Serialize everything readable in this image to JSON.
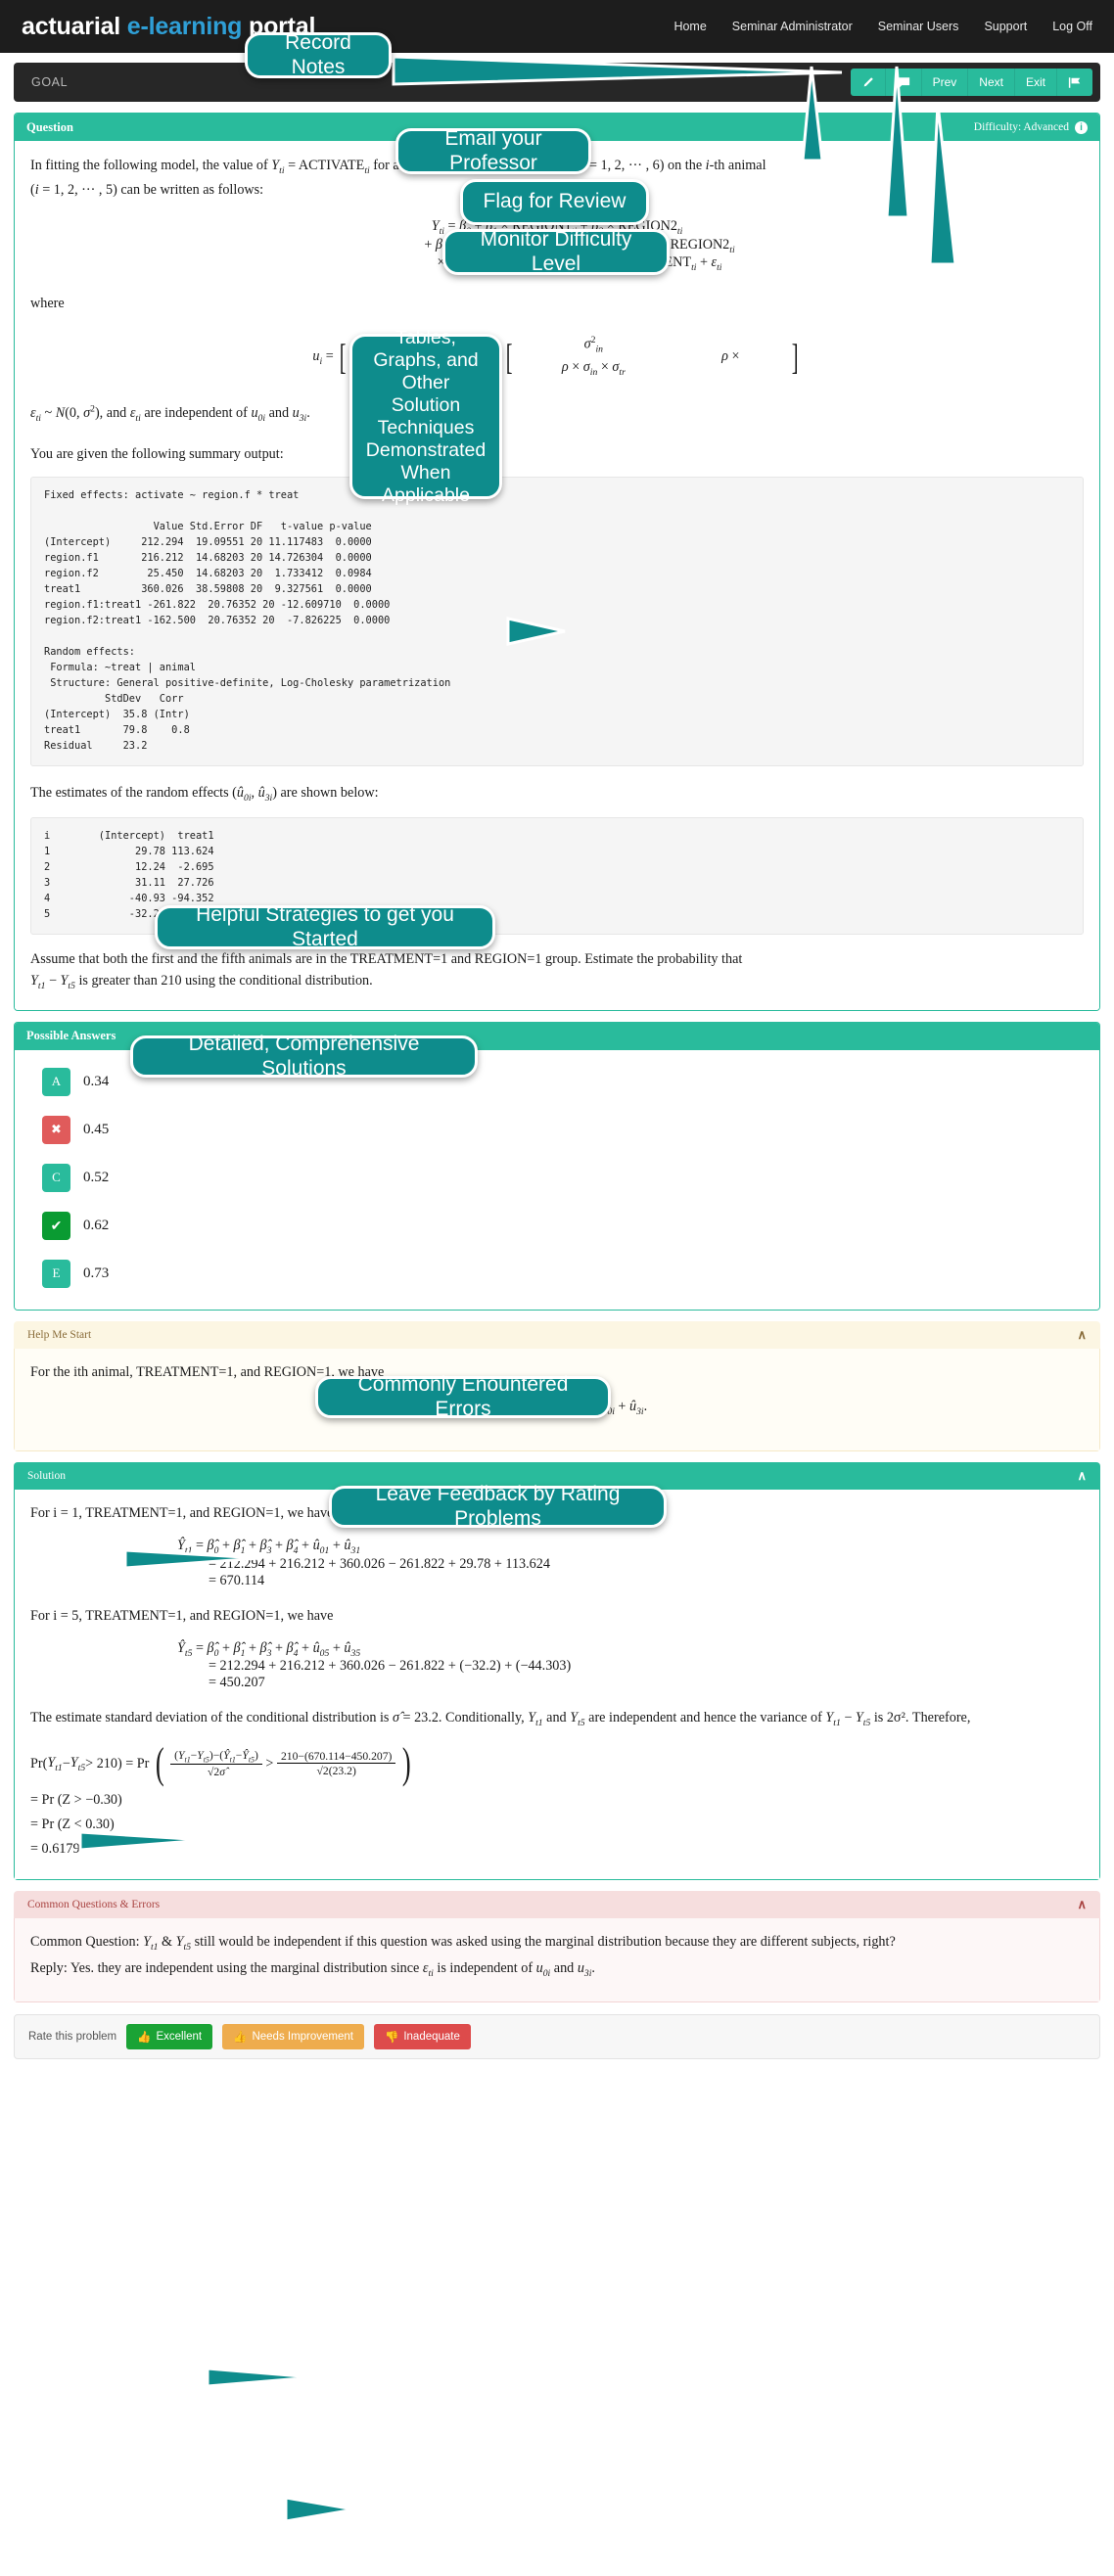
{
  "header": {
    "brand_part1": "actuarial ",
    "brand_part2": "e-learning",
    "brand_part3": " portal",
    "nav": [
      {
        "label": "Home"
      },
      {
        "label": "Seminar Administrator"
      },
      {
        "label": "Seminar Users"
      },
      {
        "label": "Support"
      },
      {
        "label": "Log Off"
      }
    ]
  },
  "goalbar": {
    "label": "GOAL",
    "buttons": [
      {
        "name": "pencil",
        "label": ""
      },
      {
        "name": "comment",
        "label": ""
      },
      {
        "name": "prev",
        "label": "Prev"
      },
      {
        "name": "next",
        "label": "Next"
      },
      {
        "name": "exit",
        "label": "Exit"
      },
      {
        "name": "flag",
        "label": ""
      }
    ]
  },
  "question": {
    "title": "Question",
    "difficulty_label": "Difficulty: Advanced",
    "info_glyph": "i",
    "intro_line1_a": "In fitting the following model, the value of ",
    "intro_line1_b": " for a given observation indexed by ",
    "intro_line1_c": " on the ",
    "intro_line1_d": "-th animal",
    "intro_line2": " can be written as follows:",
    "where_label": "where",
    "epsilon_line": " are independent of ",
    "summary_line": "You are given that the following summary output:",
    "summary_intro": "You are given the following summary output:",
    "code_fixed": "Fixed effects: activate ~ region.f * treat\n\n                  Value Std.Error DF   t-value p-value\n(Intercept)     212.294  19.09551 20 11.117483  0.0000\nregion.f1       216.212  14.68203 20 14.726304  0.0000\nregion.f2        25.450  14.68203 20  1.733412  0.0984\ntreat1          360.026  38.59808 20  9.327561  0.0000\nregion.f1:treat1 -261.822  20.76352 20 -12.609710  0.0000\nregion.f2:treat1 -162.500  20.76352 20  -7.826225  0.0000\n\nRandom effects:\n Formula: ~treat | animal\n Structure: General positive-definite, Log-Cholesky parametrization\n          StdDev   Corr\n(Intercept)  35.8 (Intr)\ntreat1       79.8    0.8\nResidual     23.2",
    "random_effects_intro": "The estimates of the random effects ",
    "random_effects_intro_tail": " are shown below:",
    "code_random": "i        (Intercept)  treat1\n1              29.78 113.624\n2              12.24  -2.695\n3              31.11  27.726\n4             -40.93 -94.352\n5             -32.20 -44.303",
    "closing_line1": "Assume that both the first and the fifth animals are in the TREATMENT=1 and REGION=1 group. Estimate the probability that",
    "closing_line2_tail": " is greater than 210 using the conditional distribution."
  },
  "answers": {
    "title": "Possible Answers",
    "options": [
      {
        "badge": "A",
        "state": "normal",
        "value": "0.34"
      },
      {
        "badge": "✖",
        "state": "wrong",
        "value": "0.45"
      },
      {
        "badge": "C",
        "state": "normal",
        "value": "0.52"
      },
      {
        "badge": "✔",
        "state": "right",
        "value": "0.62"
      },
      {
        "badge": "E",
        "state": "normal",
        "value": "0.73"
      }
    ]
  },
  "hint": {
    "title": "Help Me Start",
    "chevron": "∧",
    "text": "For the ith animal, TREATMENT=1, and REGION=1, we have"
  },
  "solution": {
    "title": "Solution",
    "chevron": "∧",
    "line1": "For i = 1, TREATMENT=1, and REGION=1, we have",
    "eq1_values": "= 212.294 + 216.212 + 360.026 − 261.822 + 29.78 + 113.624",
    "eq1_result": "= 670.114",
    "line2": "For i = 5, TREATMENT=1, and REGION=1, we have",
    "eq2_values": "= 212.294 + 216.212 + 360.026 − 261.822 + (−32.2) + (−44.303)",
    "eq2_result": "= 450.207",
    "sigma_text_a": "The estimate standard deviation of the conditional distribution is ",
    "sigma_value": "= 23.2",
    "sigma_text_b": ". Conditionally, ",
    "sigma_text_c": " are independent and hence the variance of ",
    "sigma_text_d": " is 2σ². Therefore,",
    "pr_num_right": "210−(670.114−450.207)",
    "pr_den_right": "√2(23.2)",
    "step1": "= Pr (Z > −0.30)",
    "step2": "= Pr (Z < 0.30)",
    "step3": "= 0.6179"
  },
  "cqe": {
    "title": "Common Questions & Errors",
    "chevron": "∧",
    "q_prefix": "Common Question: ",
    "q_body": " still would be independent if this question was asked using the marginal distribution because they are different subjects, right?",
    "reply_prefix": "Reply: Yes. they are independent using the marginal distribution since ",
    "reply_body": " is independent of "
  },
  "rating": {
    "label": "Rate this problem",
    "buttons": [
      {
        "label": "Excellent",
        "icon": "thumbs-up"
      },
      {
        "label": "Needs Improvement",
        "icon": "thumbs-up-outline"
      },
      {
        "label": "Inadequate",
        "icon": "thumbs-down"
      }
    ]
  },
  "callouts": [
    {
      "id": "record-notes",
      "text": "Record Notes"
    },
    {
      "id": "email-professor",
      "text": "Email your Professor"
    },
    {
      "id": "flag-review",
      "text": "Flag for Review"
    },
    {
      "id": "monitor-difficulty",
      "text": "Monitor Difficulty Level"
    },
    {
      "id": "tables-graphs",
      "text": "Tables, Graphs, and Other Solution Techniques Demonstrated When Applicable"
    },
    {
      "id": "helpful-strategies",
      "text": "Helpful Strategies to get you Started"
    },
    {
      "id": "detailed-solutions",
      "text": "Detailed, Comprehensive Solutions"
    },
    {
      "id": "common-errors",
      "text": "Commonly Enountered Errors"
    },
    {
      "id": "leave-feedback",
      "text": "Leave Feedback by Rating Problems"
    }
  ],
  "colors": {
    "accent": "#29bb9c",
    "callout": "#0e8c8c",
    "dark": "#1d1d1d",
    "brand_blue": "#2f9fd6",
    "wrong": "#e05b5b",
    "right": "#0a9b32"
  }
}
